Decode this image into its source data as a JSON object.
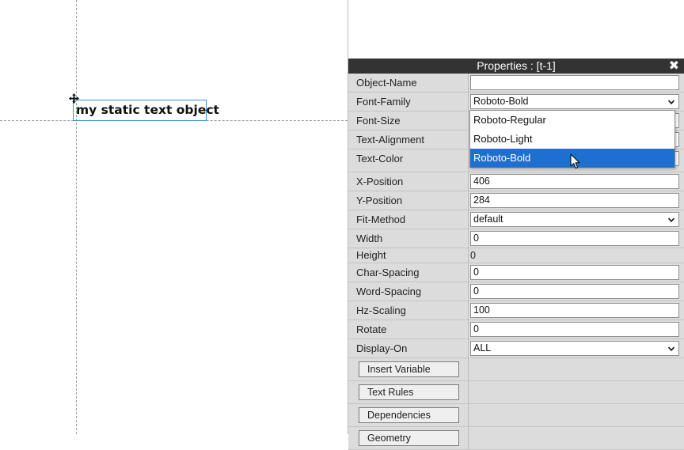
{
  "canvas": {
    "text_object": "my static text object"
  },
  "panel": {
    "title": "Properties : [t-1]",
    "close_glyph": "✖",
    "rows": {
      "object_name": {
        "label": "Object-Name",
        "value": ""
      },
      "font_family": {
        "label": "Font-Family",
        "value": "Roboto-Bold"
      },
      "font_size": {
        "label": "Font-Size"
      },
      "text_alignment": {
        "label": "Text-Alignment"
      },
      "text_color": {
        "label": "Text-Color"
      },
      "x_position": {
        "label": "X-Position",
        "value": "406"
      },
      "y_position": {
        "label": "Y-Position",
        "value": "284"
      },
      "fit_method": {
        "label": "Fit-Method",
        "value": "default"
      },
      "width": {
        "label": "Width",
        "value": "0"
      },
      "height": {
        "label": "Height",
        "value": "0"
      },
      "char_spacing": {
        "label": "Char-Spacing",
        "value": "0"
      },
      "word_spacing": {
        "label": "Word-Spacing",
        "value": "0"
      },
      "hz_scaling": {
        "label": "Hz-Scaling",
        "value": "100"
      },
      "rotate": {
        "label": "Rotate",
        "value": "0"
      },
      "display_on": {
        "label": "Display-On",
        "value": "ALL"
      }
    },
    "buttons": {
      "insert_variable": "Insert Variable",
      "text_rules": "Text Rules",
      "dependencies": "Dependencies",
      "geometry": "Geometry"
    }
  },
  "font_dropdown": {
    "options": [
      "Roboto-Regular",
      "Roboto-Light",
      "Roboto-Bold"
    ],
    "highlighted": "Roboto-Bold"
  },
  "colors": {
    "title_bar": "#333333",
    "row_bg": "#dcdcdc",
    "selection_blue": "#1f6fd1",
    "object_border": "#3b8fd9"
  }
}
